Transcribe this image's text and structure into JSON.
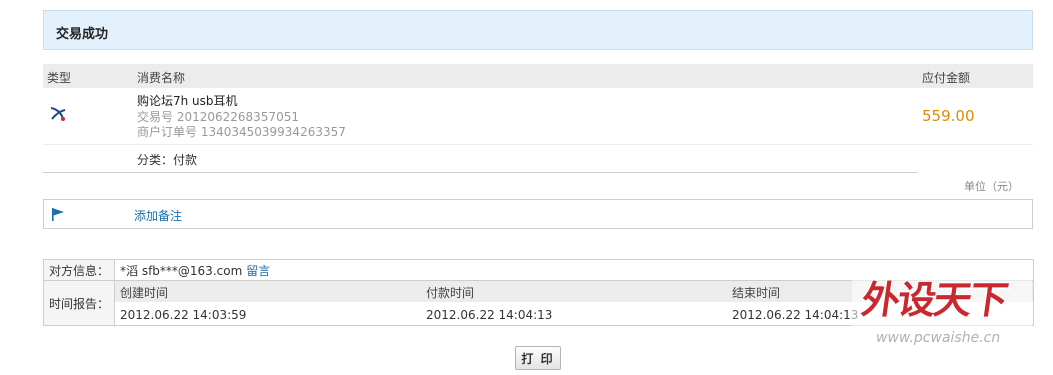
{
  "status_title": "交易成功",
  "order_table": {
    "headers": {
      "type": "类型",
      "name": "消费名称",
      "amount": "应付金额"
    },
    "item": {
      "icon": "alipay-icon",
      "product_name": "购论坛7h usb耳机",
      "trade_no": "交易号 2012062268357051",
      "merchant_order_no": "商户订单号 1340345039934263357",
      "amount": "559.00"
    },
    "category": "分类：付款"
  },
  "unit": "单位（元）",
  "remark": {
    "icon": "flag-icon",
    "link": "添加备注"
  },
  "counterparty": {
    "label": "对方信息：",
    "value": "*滔 sfb***@163.com",
    "message_link": "留言"
  },
  "time_report": {
    "label": "时间报告：",
    "columns": [
      "创建时间",
      "付款时间",
      "结束时间"
    ],
    "values": [
      "2012.06.22 14:03:59",
      "2012.06.22 14:04:13",
      "2012.06.22 14:04:13"
    ]
  },
  "print_button": "打 印",
  "watermark": {
    "main": "外设天下",
    "url": "www.pcwaishe.cn"
  },
  "colors": {
    "amount": "#e08a00",
    "link": "#1a6ea8",
    "banner": "#e2f1fc",
    "watermark": "#c8282e"
  }
}
